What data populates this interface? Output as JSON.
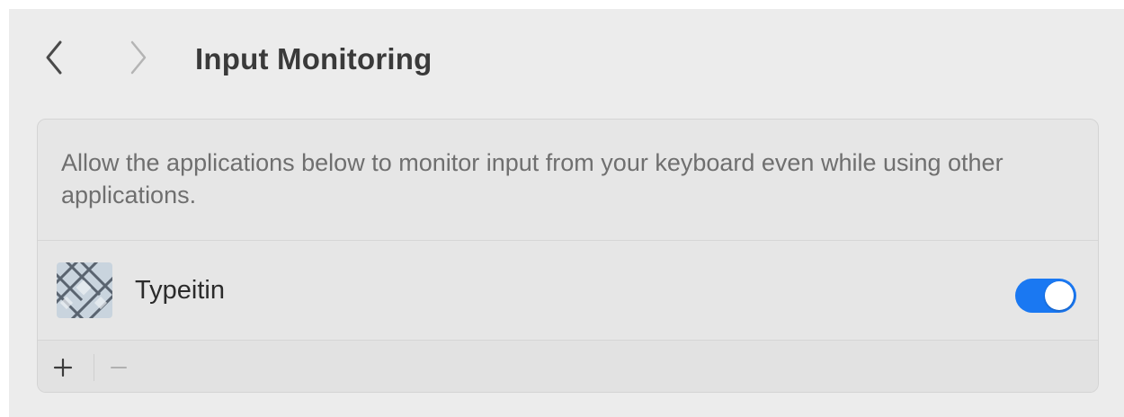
{
  "header": {
    "title": "Input Monitoring",
    "back_icon": "chevron-left-icon",
    "forward_icon": "chevron-right-icon"
  },
  "panel": {
    "description": "Allow the applications below to monitor input from your keyboard even while using other applications.",
    "apps": [
      {
        "name": "Typeitin",
        "icon": "typeitin-app-icon",
        "enabled": true
      }
    ],
    "footer": {
      "add_icon": "plus-icon",
      "remove_icon": "minus-icon"
    }
  },
  "colors": {
    "toggle_on": "#1a78f2",
    "background": "#ececec",
    "panel": "#e6e6e6"
  }
}
